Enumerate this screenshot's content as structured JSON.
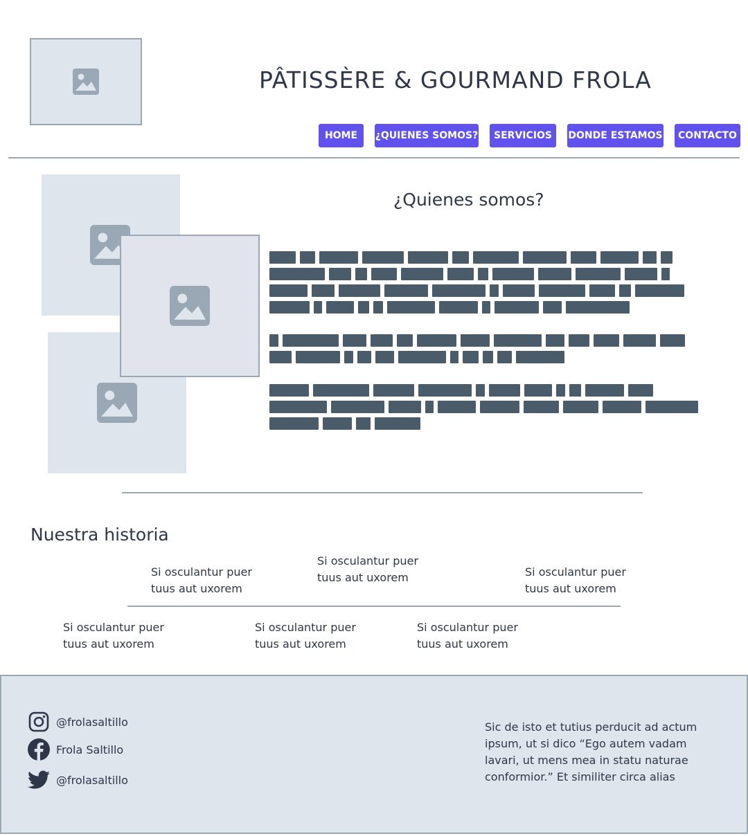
{
  "header": {
    "title": "PÂTISSÈRE & GOURMAND  FROLA",
    "logo_icon": "image-placeholder-icon"
  },
  "nav": {
    "items": [
      {
        "label": "HOME"
      },
      {
        "label": "¿QUIENES SOMOS?"
      },
      {
        "label": "SERVICIOS"
      },
      {
        "label": "DONDE ESTAMOS"
      },
      {
        "label": "CONTACTO"
      }
    ]
  },
  "about": {
    "title": "¿Quienes somos?",
    "image_icon": "image-placeholder-icon"
  },
  "history": {
    "title": "Nuestra historia",
    "events": [
      {
        "line1": "Si osculantur puer",
        "line2": "tuus aut uxorem"
      },
      {
        "line1": "Si osculantur puer",
        "line2": "tuus aut uxorem"
      },
      {
        "line1": "Si osculantur puer",
        "line2": "tuus aut uxorem"
      },
      {
        "line1": "Si osculantur puer",
        "line2": "tuus aut uxorem"
      },
      {
        "line1": "Si osculantur puer",
        "line2": "tuus aut uxorem"
      },
      {
        "line1": "Si osculantur puer",
        "line2": "tuus aut uxorem"
      }
    ]
  },
  "footer": {
    "social": [
      {
        "icon": "instagram-icon",
        "label": "@frolasaltillo"
      },
      {
        "icon": "facebook-icon",
        "label": "Frola Saltillo"
      },
      {
        "icon": "twitter-icon",
        "label": "@frolasaltillo"
      }
    ],
    "text": "Sic de isto et tutius perducit ad actum ipsum, ut si dico “Ego autem vadam lavari, ut mens mea in statu naturae conformior.” Et similiter circa alias"
  },
  "colors": {
    "accent": "#6152f0",
    "placeholder_bg": "#dfe5ed",
    "placeholder_icon": "#9aa8b5",
    "redacted_text": "#4a5c6a",
    "rule": "#9aa8b5"
  }
}
